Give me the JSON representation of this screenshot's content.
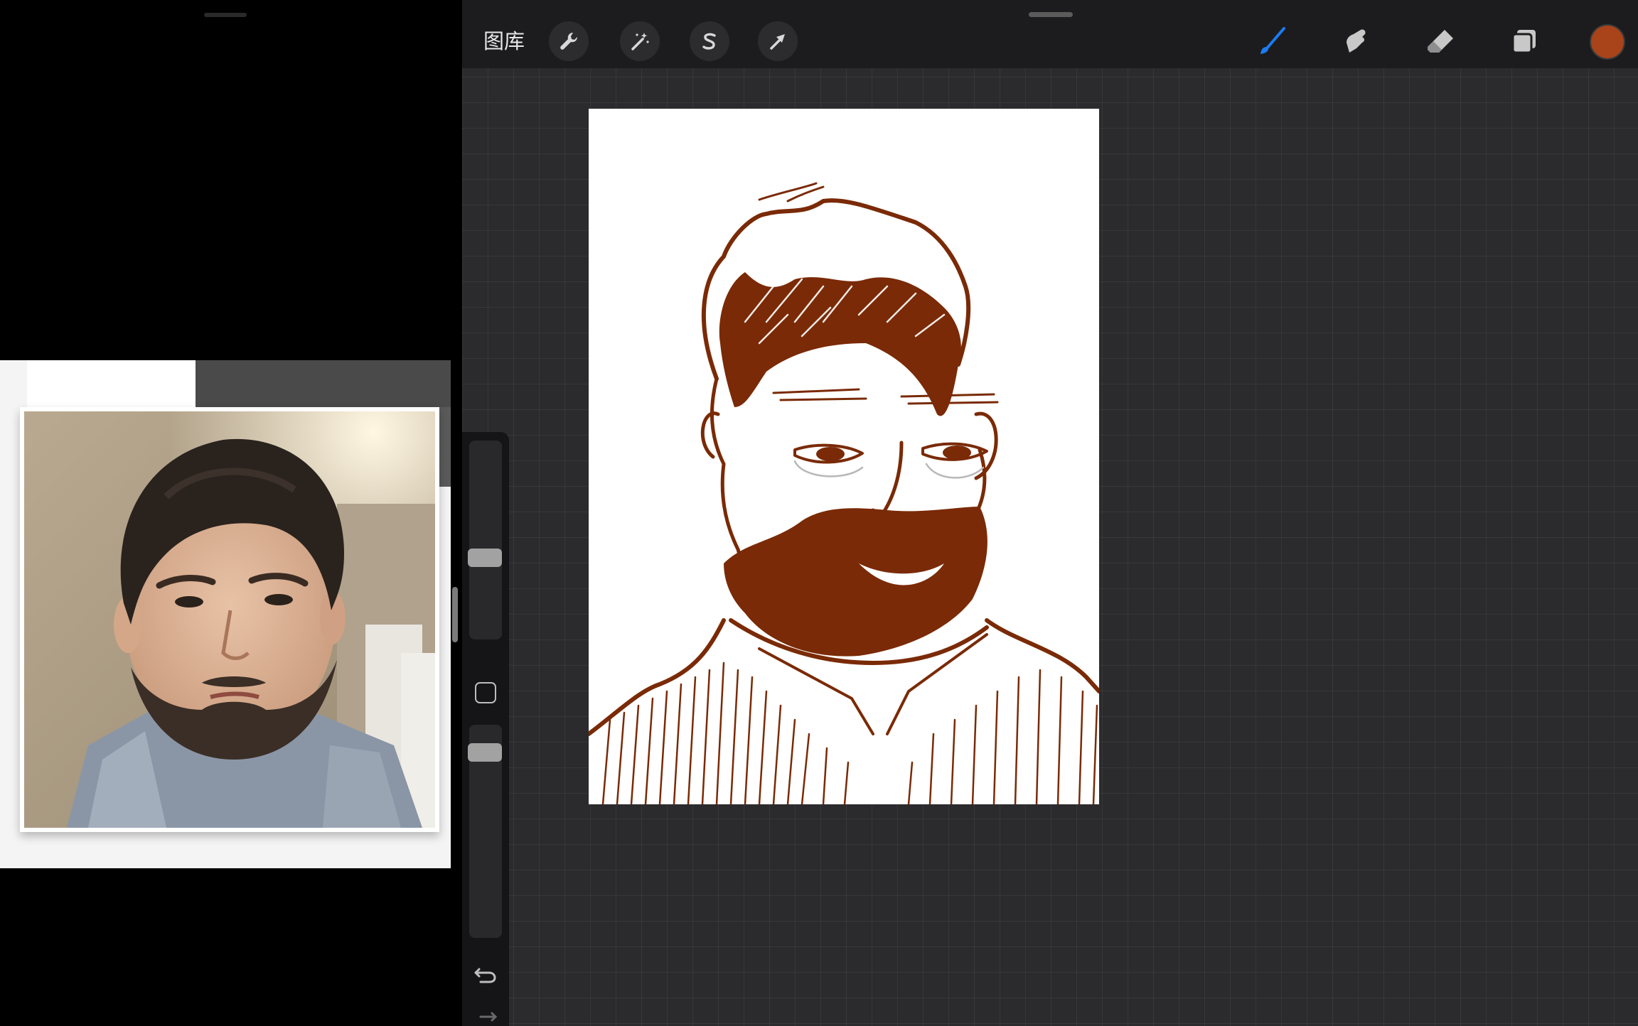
{
  "toolbar": {
    "gallery_label": "图库",
    "actions_icon": "wrench-icon",
    "adjustments_icon": "magic-wand-icon",
    "selection_icon": "selection-s-icon",
    "transform_icon": "arrow-cursor-icon",
    "brush_icon": "brush-icon",
    "smudge_icon": "smudge-finger-icon",
    "eraser_icon": "eraser-icon",
    "layers_icon": "layers-icon"
  },
  "colors": {
    "active_color": "#a8431a",
    "ink": "#7a2a06",
    "tool_active": "#1b7cf2"
  },
  "sidebar": {
    "brush_size_level": 0.56,
    "opacity_level": 0.95,
    "modify_icon": "square-icon",
    "undo_icon": "undo-icon",
    "redo_icon": "redo-icon"
  },
  "reference": {
    "subject": "selfie-photo"
  }
}
